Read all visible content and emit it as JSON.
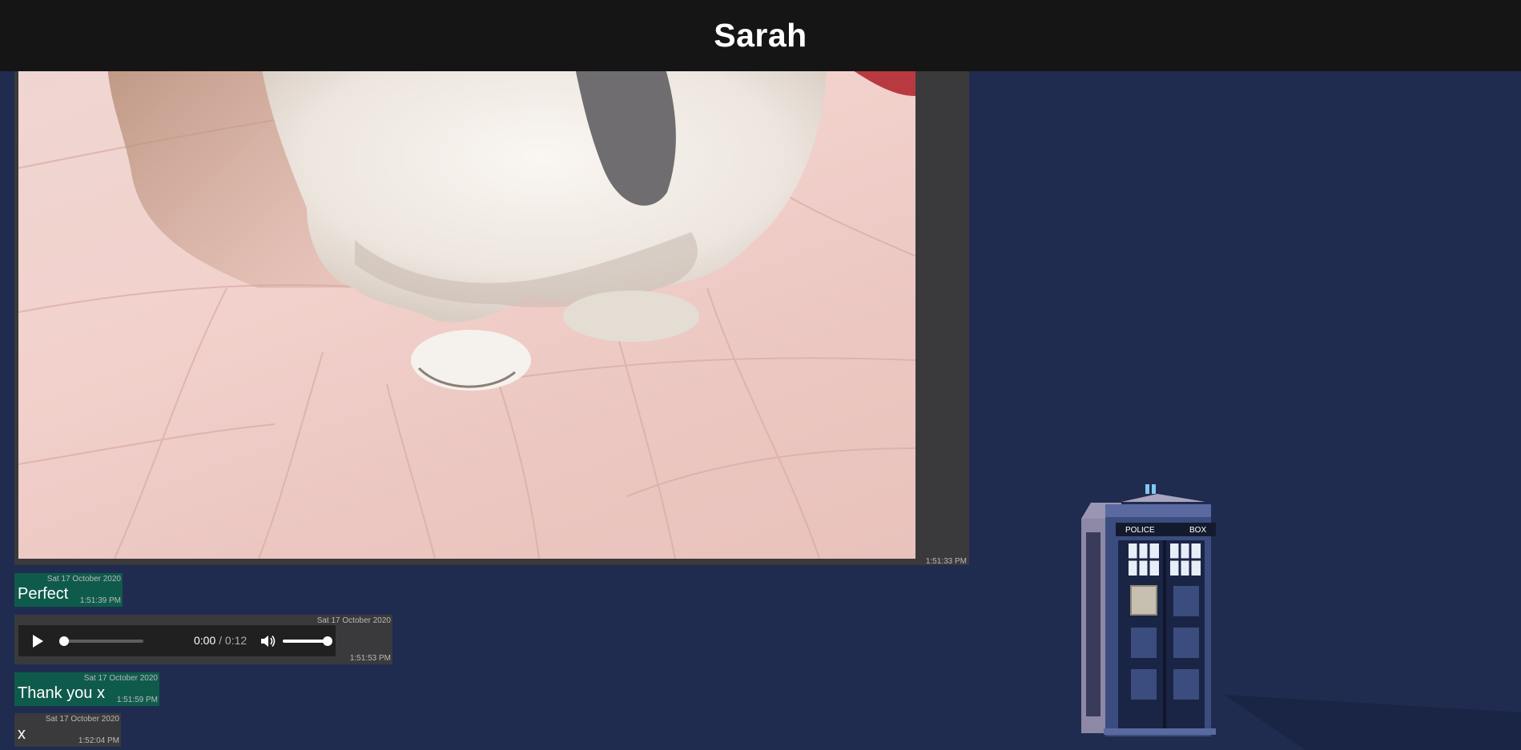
{
  "header": {
    "title": "Sarah"
  },
  "messages": [
    {
      "type": "image",
      "time": "1:51:33 PM"
    },
    {
      "type": "text",
      "date": "Sat 17 October 2020",
      "text": "Perfect",
      "time": "1:51:39 PM"
    },
    {
      "type": "audio",
      "date": "Sat 17 October 2020",
      "current": "0:00",
      "separator": "/",
      "duration": "0:12",
      "time": "1:51:53 PM"
    },
    {
      "type": "text",
      "date": "Sat 17 October 2020",
      "text": "Thank you x",
      "time": "1:51:59 PM"
    },
    {
      "type": "text",
      "date": "Sat 17 October 2020",
      "text": "x",
      "time": "1:52:04 PM"
    }
  ],
  "audio_player": {
    "progress": 0,
    "volume": 1.0
  },
  "tardis": {
    "sign_left": "POLICE",
    "sign_right": "BOX"
  },
  "colors": {
    "background": "#1f2c4f",
    "header": "#151515",
    "outgoing_bubble": "#0f5b4b",
    "incoming_bubble": "#3a3a3c"
  }
}
